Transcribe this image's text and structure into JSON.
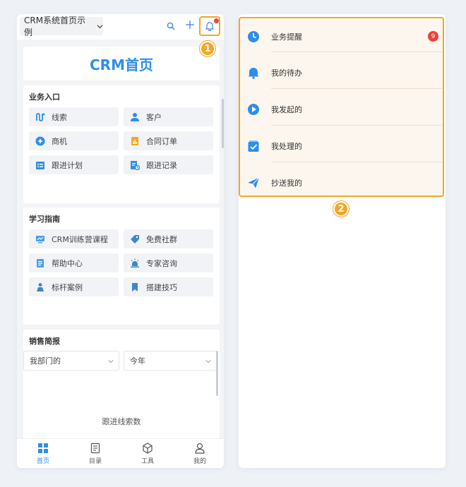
{
  "topbar": {
    "app_selector": "CRM系统首页示例",
    "icons": [
      "search-icon",
      "plus-icon",
      "bell-icon"
    ]
  },
  "home": {
    "title": "CRM首页"
  },
  "business_entry": {
    "title": "业务入口",
    "items": [
      {
        "label": "线索",
        "icon": "leads-icon",
        "color": "#2e8ee8"
      },
      {
        "label": "客户",
        "icon": "customer-icon",
        "color": "#2e8ee8"
      },
      {
        "label": "商机",
        "icon": "opportunity-icon",
        "color": "#2e8ee8"
      },
      {
        "label": "合同订单",
        "icon": "contract-icon",
        "color": "#f5a623"
      },
      {
        "label": "跟进计划",
        "icon": "plan-icon",
        "color": "#2e8ee8"
      },
      {
        "label": "跟进记录",
        "icon": "record-icon",
        "color": "#2e8ee8"
      }
    ]
  },
  "learning": {
    "title": "学习指南",
    "items": [
      {
        "label": "CRM训练营课程",
        "icon": "course-icon"
      },
      {
        "label": "免费社群",
        "icon": "tag-icon"
      },
      {
        "label": "帮助中心",
        "icon": "help-doc-icon"
      },
      {
        "label": "专家咨询",
        "icon": "expert-icon"
      },
      {
        "label": "标杆案例",
        "icon": "case-icon"
      },
      {
        "label": "搭建技巧",
        "icon": "bookmark-icon"
      }
    ]
  },
  "sales_report": {
    "title": "销售简报",
    "filter_scope": "我部门的",
    "filter_period": "今年",
    "metric_label": "跟进线索数"
  },
  "bottom_nav": [
    {
      "label": "首页",
      "icon": "grid-icon",
      "active": true
    },
    {
      "label": "目录",
      "icon": "catalog-icon",
      "active": false
    },
    {
      "label": "工具",
      "icon": "cube-icon",
      "active": false
    },
    {
      "label": "我的",
      "icon": "user-icon",
      "active": false
    }
  ],
  "callouts": [
    "1",
    "2"
  ],
  "notifications": {
    "items": [
      {
        "label": "业务提醒",
        "icon": "clock-icon",
        "count": "9"
      },
      {
        "label": "我的待办",
        "icon": "bell-icon"
      },
      {
        "label": "我发起的",
        "icon": "play-icon"
      },
      {
        "label": "我处理的",
        "icon": "check-box-icon"
      },
      {
        "label": "抄送我的",
        "icon": "paper-plane-icon"
      }
    ]
  },
  "colors": {
    "accent": "#2e8ee8",
    "highlight": "#f5a623",
    "badge": "#ee4036"
  }
}
